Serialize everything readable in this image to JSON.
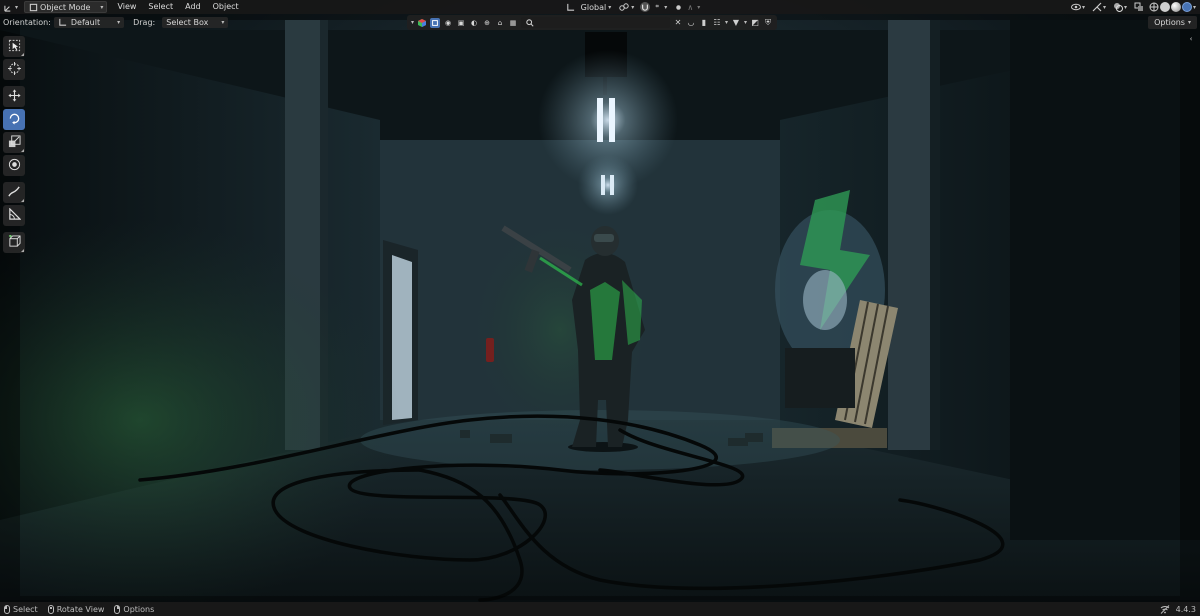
{
  "header": {
    "editor_type_icon": "transform-axes-icon",
    "mode": "Object Mode",
    "menus": [
      "View",
      "Select",
      "Add",
      "Object"
    ],
    "transform_orientation": "Global",
    "pivot_icon": "link-icon",
    "snap_icon": "snap-magnet-icon",
    "proportional_icon": "proportional-editing-icon"
  },
  "tool_header": {
    "orientation_label": "Orientation:",
    "orientation_value": "Default",
    "drag_label": "Drag:",
    "drag_value": "Select Box",
    "options_label": "Options"
  },
  "search": {
    "placeholder": "",
    "value": ""
  },
  "toolbar": {
    "tools": [
      {
        "name": "select-box-tool",
        "icon": "select-box-icon",
        "active": false
      },
      {
        "name": "cursor-tool",
        "icon": "cursor-icon",
        "active": false
      },
      {
        "name": "move-tool",
        "icon": "move-icon",
        "active": false
      },
      {
        "name": "rotate-tool",
        "icon": "rotate-icon",
        "active": true
      },
      {
        "name": "scale-tool",
        "icon": "scale-icon",
        "active": false
      },
      {
        "name": "transform-tool",
        "icon": "transform-icon",
        "active": false
      },
      {
        "name": "annotate-tool",
        "icon": "annotate-icon",
        "active": false
      },
      {
        "name": "measure-tool",
        "icon": "measure-icon",
        "active": false
      },
      {
        "name": "add-cube-tool",
        "icon": "add-cube-icon",
        "active": false
      }
    ]
  },
  "statusbar": {
    "items": [
      {
        "icon": "mouse-left-icon",
        "label": "Select"
      },
      {
        "icon": "mouse-middle-icon",
        "label": "Rotate View"
      },
      {
        "icon": "mouse-right-icon",
        "label": "Options"
      }
    ],
    "version": "4.4.3"
  },
  "colors": {
    "active_tool": "#4772b3",
    "header_bg": "#181818",
    "scene_fog": "#1e3a2e",
    "soldier_accent": "#2fbf4f",
    "light": "#e8f4ff"
  }
}
